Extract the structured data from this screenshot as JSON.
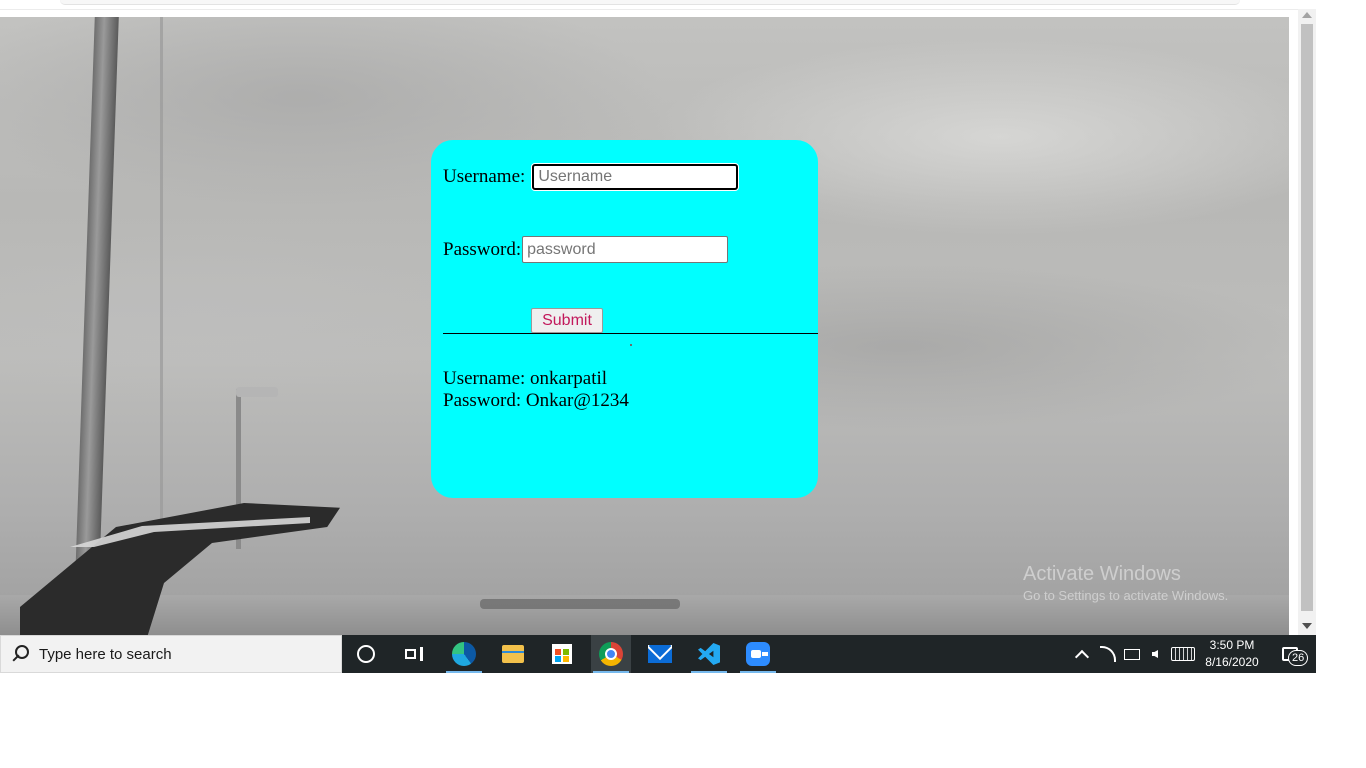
{
  "form": {
    "username_label": "Username:",
    "username_placeholder": "Username",
    "username_value": "",
    "password_label": "Password:",
    "password_placeholder": "password",
    "password_value": "",
    "submit_label": "Submit"
  },
  "credentials": {
    "username_line": "Username: onkarpatil",
    "password_line": "Password: Onkar@1234"
  },
  "watermark": {
    "line1": "Activate Windows",
    "line2": "Go to Settings to activate Windows."
  },
  "taskbar": {
    "search_placeholder": "Type here to search",
    "apps": [
      "cortana-icon",
      "task-view-icon",
      "edge-icon",
      "file-explorer-icon",
      "store-icon",
      "chrome-icon",
      "mail-icon",
      "vscode-icon",
      "zoom-icon"
    ],
    "time": "3:50 PM",
    "date": "8/16/2020",
    "notification_count": "26"
  },
  "colors": {
    "card_background": "#00ffff",
    "submit_text": "#c2185b",
    "taskbar_background": "#1f2527"
  }
}
